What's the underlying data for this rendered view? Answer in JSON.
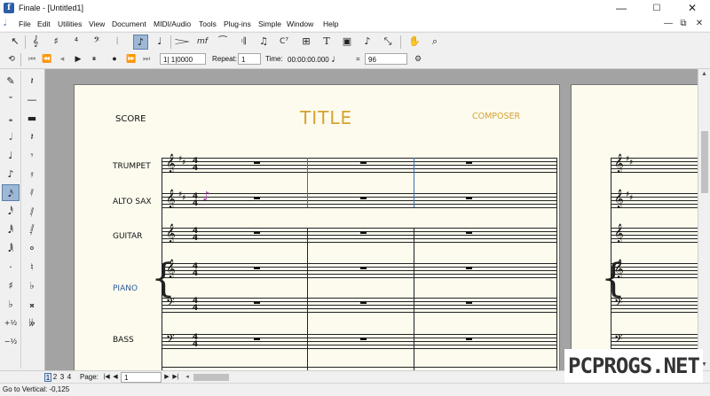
{
  "window": {
    "title": "Finale - [Untitled1]",
    "app_icon": "finale-f-icon",
    "controls": {
      "minimize": "—",
      "maximize": "☐",
      "close": "✕"
    }
  },
  "menu": {
    "items": [
      "File",
      "Edit",
      "Utilities",
      "View",
      "Document",
      "MIDI/Audio",
      "Tools",
      "Plug-ins",
      "Simple",
      "Window",
      "Help"
    ],
    "mdi_controls": {
      "minimize": "—",
      "restore": "⧉",
      "close": "✕"
    }
  },
  "toolbar_main": {
    "tools": [
      {
        "name": "selection-tool",
        "glyph": "↖"
      },
      {
        "name": "staff-tool",
        "glyph": "𝄞"
      },
      {
        "name": "key-signature-tool",
        "glyph": "♯"
      },
      {
        "name": "time-signature-tool",
        "glyph": "⁴"
      },
      {
        "name": "clef-tool",
        "glyph": "𝄢"
      },
      {
        "name": "measure-tool",
        "glyph": "𝄀"
      },
      {
        "name": "simple-entry-tool",
        "glyph": "♪",
        "active": true
      },
      {
        "name": "speedy-entry-tool",
        "glyph": "♩"
      },
      {
        "name": "articulation-tool",
        "glyph": "𝆓"
      },
      {
        "name": "expression-tool",
        "glyph": "mf"
      },
      {
        "name": "smart-shape-tool",
        "glyph": "⁀"
      },
      {
        "name": "repeat-tool",
        "glyph": "𝄇"
      },
      {
        "name": "lyrics-tool",
        "glyph": "♫"
      },
      {
        "name": "chord-tool",
        "glyph": "C⁷"
      },
      {
        "name": "staff-styles-tool",
        "glyph": "⊞"
      },
      {
        "name": "text-tool",
        "glyph": "T"
      },
      {
        "name": "graphics-tool",
        "glyph": "▣"
      },
      {
        "name": "mirror-tool",
        "glyph": "♪"
      },
      {
        "name": "resize-tool",
        "glyph": "⤡"
      },
      {
        "name": "hand-grabber-tool",
        "glyph": "✋"
      },
      {
        "name": "zoom-tool",
        "glyph": "⌕"
      }
    ]
  },
  "playback": {
    "controls": [
      "⟲",
      "⏮",
      "⏪",
      "◂",
      "▶",
      "⏸",
      "●",
      "⏩",
      "⏭"
    ],
    "position": "1| 1|0000",
    "repeat_label": "Repeat:",
    "repeat_value": "1",
    "time_label": "Time:",
    "time_value": "00:00:00.000",
    "tempo_note": "♩",
    "tempo_equals": "=",
    "tempo_value": "96",
    "settings_icon": "gear-icon"
  },
  "palette": {
    "left": [
      "✎",
      "𝄻",
      "𝅝",
      "𝅗𝅥",
      "♩",
      "♪",
      "𝅘𝅥𝅯",
      "𝅘𝅥𝅰",
      "𝅘𝅥𝅱",
      "𝅘𝅥𝅲",
      "·",
      "♯",
      "♭",
      "+½",
      "−½"
    ],
    "left_active": 6,
    "right": [
      "𝄽",
      "—",
      "▬",
      "𝄽",
      "𝄾",
      "𝄿",
      "𝅀",
      "𝅁",
      "𝅂",
      "⚬",
      "♮",
      "♭",
      "𝄪",
      "𝄫"
    ]
  },
  "score": {
    "label": "SCORE",
    "title": "TITLE",
    "composer": "COMPOSER",
    "instruments": [
      "TRUMPET",
      "ALTO SAX",
      "GUITAR",
      "PIANO",
      "BASS"
    ],
    "piano_color": "#2d5a9a",
    "title_color": "#d8a231",
    "time_signature": "4/4"
  },
  "bottom": {
    "page_tabs": [
      "1",
      "2",
      "3",
      "4"
    ],
    "active_tab": 0,
    "page_label": "Page:",
    "page_value": "1"
  },
  "status": {
    "text": "Go to Vertical: -0,125"
  },
  "watermark": {
    "text": "PCPROGS.NET"
  }
}
